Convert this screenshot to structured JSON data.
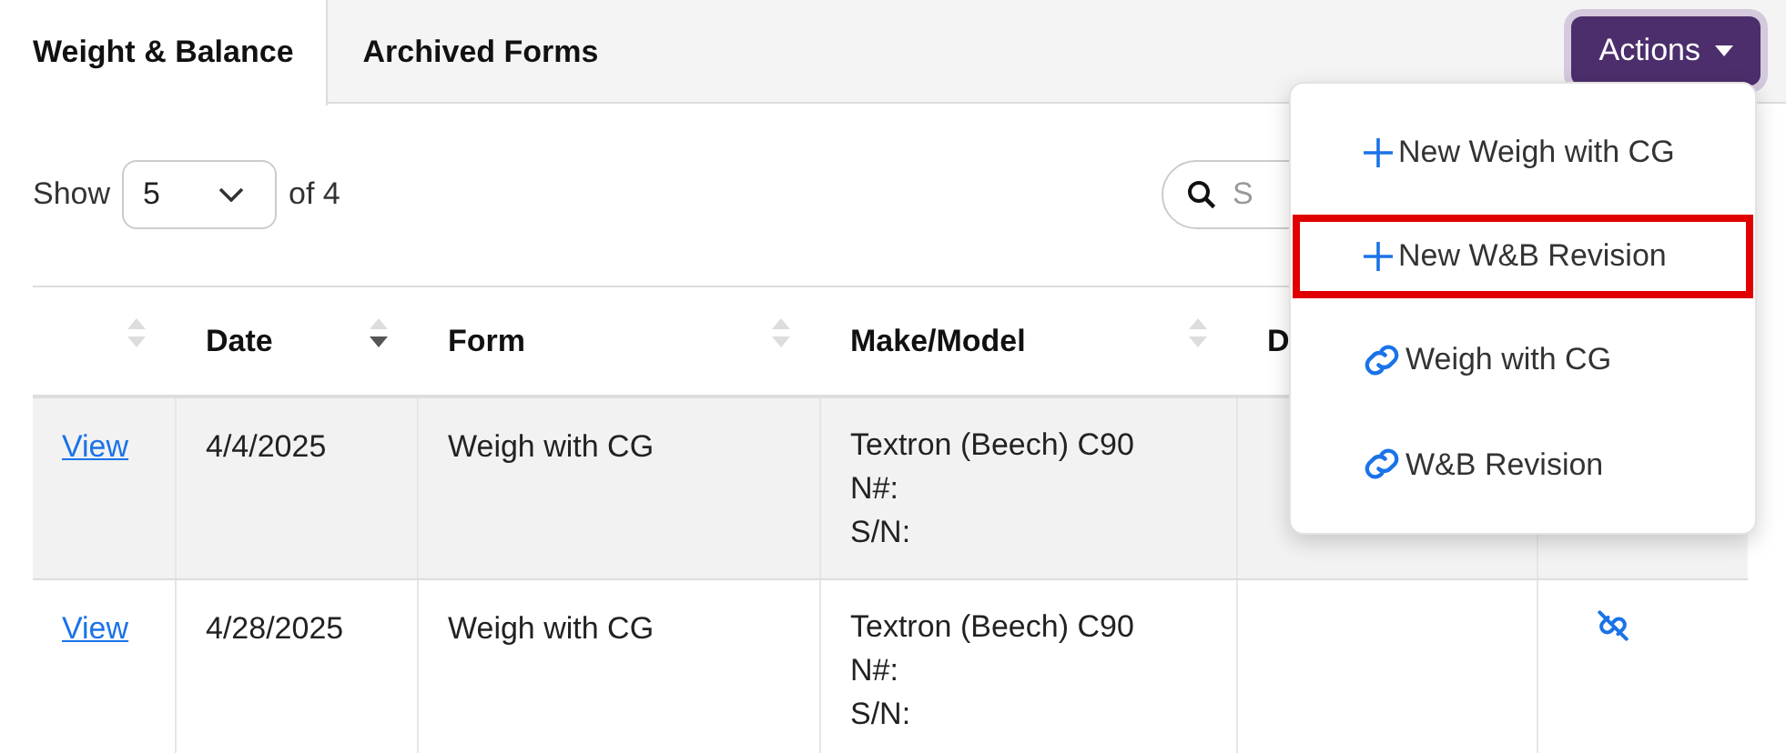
{
  "tabs": [
    {
      "label": "Weight & Balance",
      "selected": true
    },
    {
      "label": "Archived Forms",
      "selected": false
    }
  ],
  "actions_button": {
    "label": "Actions"
  },
  "actions_menu": {
    "items": [
      {
        "label": "New Weigh with CG",
        "kind": "plus",
        "highlighted": false
      },
      {
        "label": "New W&B Revision",
        "kind": "plus",
        "highlighted": true
      },
      {
        "label": "Weigh with CG",
        "kind": "link",
        "highlighted": false
      },
      {
        "label": "W&B Revision",
        "kind": "link",
        "highlighted": false
      }
    ]
  },
  "page_size": {
    "label": "Show",
    "value": "5",
    "total": "of 4"
  },
  "search": {
    "placeholder": "S"
  },
  "table": {
    "columns": [
      {
        "sorted_desc": false
      },
      {
        "label": "Date",
        "sorted_desc": true
      },
      {
        "label": "Form",
        "sorted_desc": false
      },
      {
        "label": "Make/Model",
        "sorted_desc": false
      },
      {
        "label": "D"
      }
    ],
    "rows": [
      {
        "link": "View",
        "date": "4/4/2025",
        "form": "Weigh with CG",
        "make_model": [
          "Textron (Beech) C90",
          "N#:",
          "S/N:"
        ]
      },
      {
        "link": "View",
        "date": "4/28/2025",
        "form": "Weigh with CG",
        "make_model": [
          "Textron (Beech) C90",
          "N#:",
          "S/N:"
        ],
        "unlinked": true
      }
    ]
  }
}
